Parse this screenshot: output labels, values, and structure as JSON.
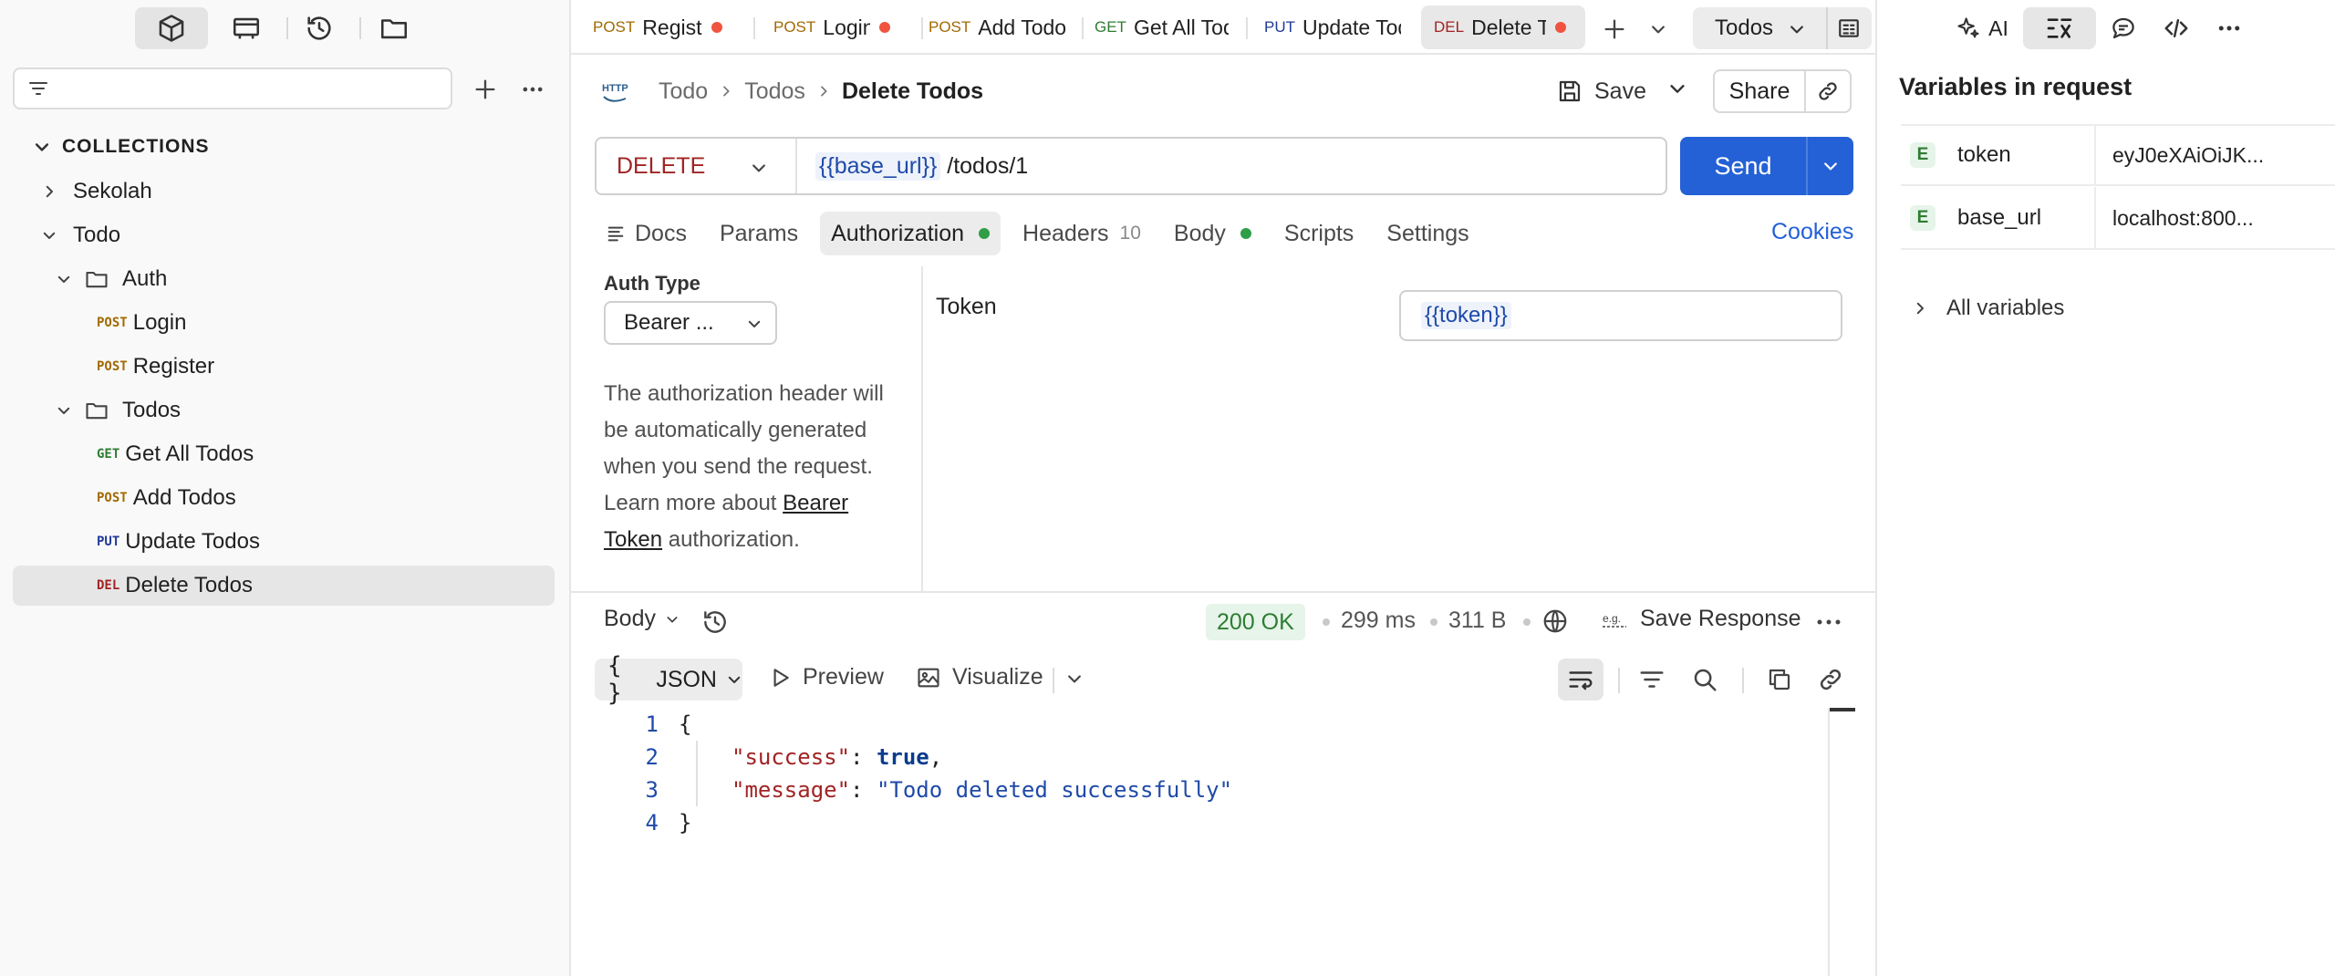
{
  "sidebar": {
    "filter_placeholder": "",
    "collections_label": "COLLECTIONS",
    "tree": [
      {
        "label": "Sekolah",
        "method": ""
      },
      {
        "label": "Todo",
        "method": ""
      },
      {
        "label": "Auth",
        "method": ""
      },
      {
        "label": "Login",
        "method": "POST"
      },
      {
        "label": "Register",
        "method": "POST"
      },
      {
        "label": "Todos",
        "method": ""
      },
      {
        "label": "Get All Todos",
        "method": "GET"
      },
      {
        "label": "Add Todos",
        "method": "POST"
      },
      {
        "label": "Update Todos",
        "method": "PUT"
      },
      {
        "label": "Delete Todos",
        "method": "DEL"
      }
    ]
  },
  "tabs": [
    {
      "method": "POST",
      "name": "Regist"
    },
    {
      "method": "POST",
      "name": "Login"
    },
    {
      "method": "POST",
      "name": "Add Todos"
    },
    {
      "method": "GET",
      "name": "Get All Todos"
    },
    {
      "method": "PUT",
      "name": "Update Todos"
    },
    {
      "method": "DEL",
      "name": "Delete Todos"
    }
  ],
  "environment": "Todos",
  "right_panel": {
    "ai_label": "AI",
    "title": "Variables in request",
    "variables": [
      {
        "scope": "E",
        "name": "token",
        "value": "eyJ0eXAiOiJK..."
      },
      {
        "scope": "E",
        "name": "base_url",
        "value": "localhost:800..."
      }
    ],
    "all_variables": "All variables"
  },
  "request": {
    "http_badge": "HTTP",
    "breadcrumb": [
      "Todo",
      "Todos",
      "Delete Todos"
    ],
    "save_label": "Save",
    "share_label": "Share",
    "method": "DELETE",
    "url_var": "{{base_url}}",
    "url_path": " /todos/1",
    "send_label": "Send",
    "tabs": {
      "docs": "Docs",
      "params": "Params",
      "authorization": "Authorization",
      "headers": "Headers",
      "headers_count": "10",
      "body": "Body",
      "scripts": "Scripts",
      "settings": "Settings"
    },
    "cookies_label": "Cookies",
    "auth": {
      "type_label": "Auth Type",
      "type_value": "Bearer ...",
      "desc_text": "The authorization header will be automatically generated when you send the request. Learn more about ",
      "desc_link": "Bearer Token",
      "desc_tail": " authorization.",
      "token_label": "Token",
      "token_value": "{{token}}"
    }
  },
  "response": {
    "body_label": "Body",
    "status": "200 OK",
    "time": "299 ms",
    "size": "311 B",
    "save_response": "Save Response",
    "format": "JSON",
    "format_icon": "{ }",
    "preview_label": "Preview",
    "visualize_label": "Visualize",
    "lines": [
      {
        "num": "1",
        "open": "{"
      },
      {
        "num": "2",
        "key": "\"success\"",
        "sep": ": ",
        "val": "true",
        "tail": ","
      },
      {
        "num": "3",
        "key": "\"message\"",
        "sep": ": ",
        "val": "\"Todo deleted successfully\"",
        "tail": ""
      },
      {
        "num": "4",
        "close": "}"
      }
    ]
  }
}
